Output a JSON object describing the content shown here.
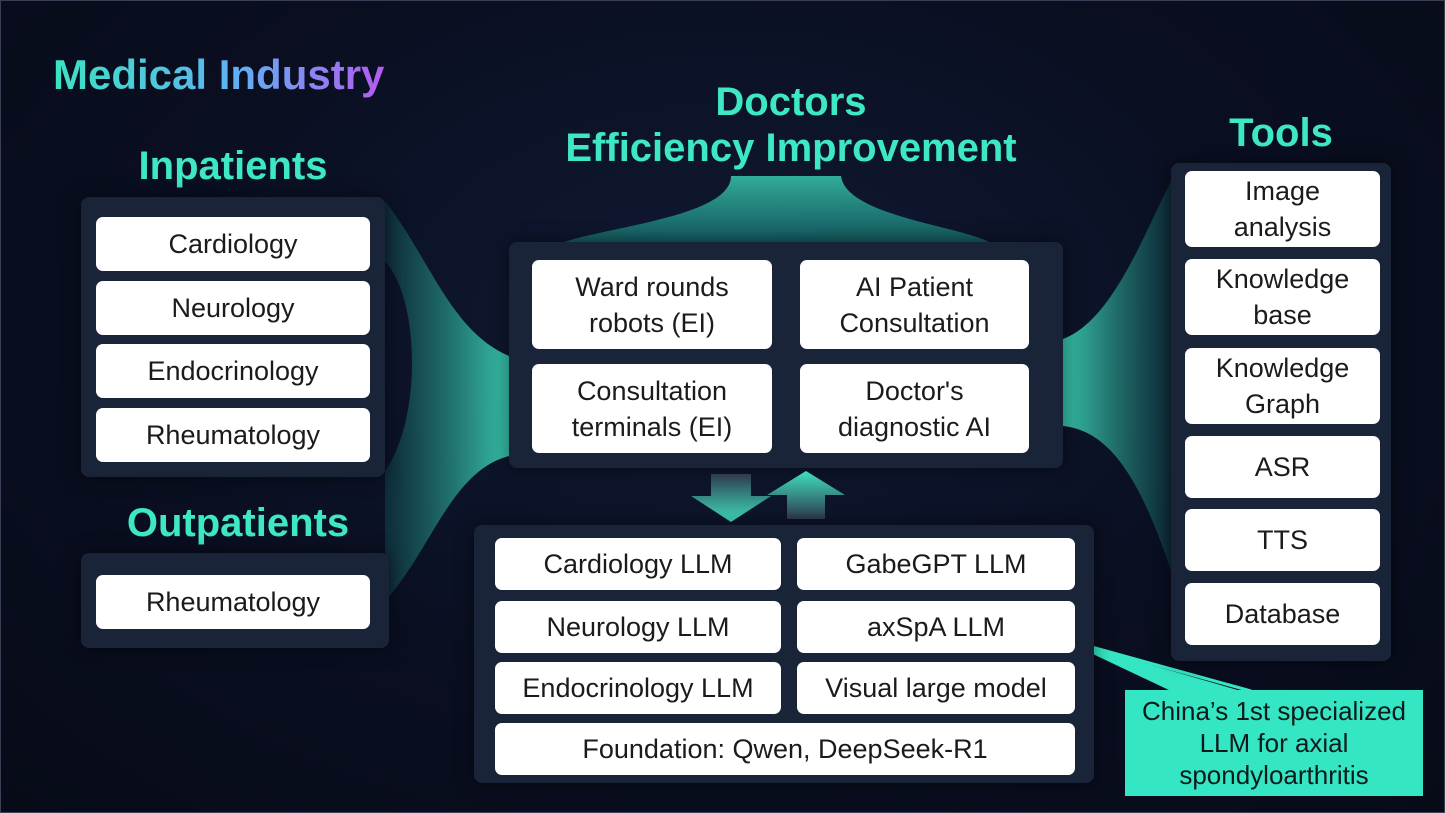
{
  "title": "Medical Industry",
  "inpatients": {
    "heading": "Inpatients",
    "items": [
      "Cardiology",
      "Neurology",
      "Endocrinology",
      "Rheumatology"
    ]
  },
  "outpatients": {
    "heading": "Outpatients",
    "items": [
      "Rheumatology"
    ]
  },
  "doctors": {
    "heading_line1": "Doctors",
    "heading_line2": "Efficiency Improvement",
    "items": [
      {
        "line1": "Ward rounds",
        "line2": "robots (EI)"
      },
      {
        "line1": "AI Patient",
        "line2": "Consultation"
      },
      {
        "line1": "Consultation",
        "line2": "terminals (EI)"
      },
      {
        "line1": "Doctor's",
        "line2": "diagnostic AI"
      }
    ]
  },
  "models": {
    "items": [
      "Cardiology LLM",
      "GabeGPT LLM",
      "Neurology LLM",
      "axSpA LLM",
      "Endocrinology LLM",
      "Visual large model"
    ],
    "foundation": "Foundation: Qwen, DeepSeek-R1"
  },
  "tools": {
    "heading": "Tools",
    "items": [
      {
        "line1": "Image",
        "line2": "analysis"
      },
      {
        "line1": "Knowledge",
        "line2": "base"
      },
      {
        "line1": "Knowledge",
        "line2": "Graph"
      },
      {
        "line1": "ASR",
        "line2": ""
      },
      {
        "line1": "TTS",
        "line2": ""
      },
      {
        "line1": "Database",
        "line2": ""
      }
    ]
  },
  "callout": {
    "line1": "China’s 1st specialized",
    "line2": "LLM for axial",
    "line3": "spondyloarthritis"
  },
  "colors": {
    "accent": "#3ee8c4",
    "panel": "#1a2438",
    "background": "#0b1022",
    "callout": "#35e6c4"
  }
}
